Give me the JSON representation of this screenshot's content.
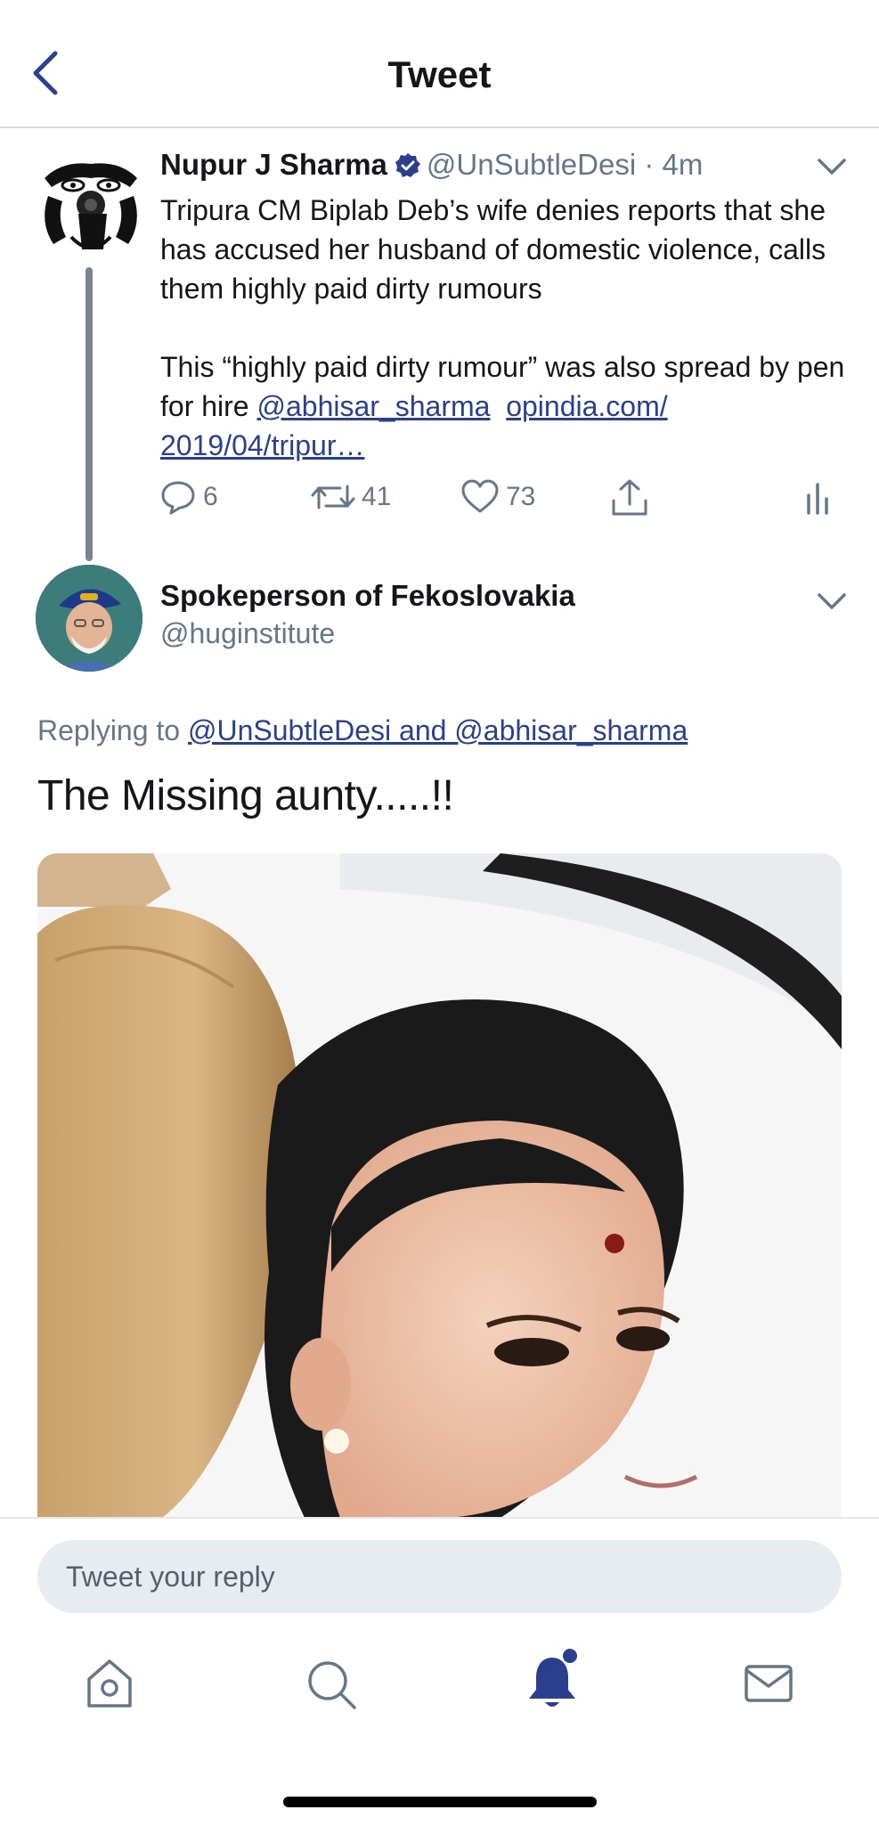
{
  "header": {
    "title": "Tweet"
  },
  "tweet1": {
    "name": "Nupur J Sharma",
    "handle": "@UnSubtleDesi",
    "time": "· 4m",
    "text_p1": "Tripura CM Biplab Deb’s wife denies reports that she has accused her husband of domestic violence, calls them highly paid dirty rumours",
    "text_p2_start": "This “highly paid dirty rumour” was also spread by pen for hire ",
    "mention": "@abhisar_sharma",
    "link_line1": "opindia.com/",
    "link_line2": "2019/04/tripur…",
    "replies": "6",
    "retweets": "41",
    "likes": "73"
  },
  "tweet2": {
    "name": "Spokeperson of Fekoslovakia",
    "handle": "@huginstitute",
    "replying_prefix": "Replying to ",
    "replying_to": "@UnSubtleDesi and @abhisar_sharma",
    "text": "The Missing aunty.....!!"
  },
  "reply": {
    "placeholder": "Tweet your reply"
  },
  "colors": {
    "accent": "#2b3f8f",
    "muted": "#657786",
    "verified": "#2b3f8f"
  },
  "tabs": [
    "home-icon",
    "search-icon",
    "notifications-icon",
    "messages-icon"
  ]
}
